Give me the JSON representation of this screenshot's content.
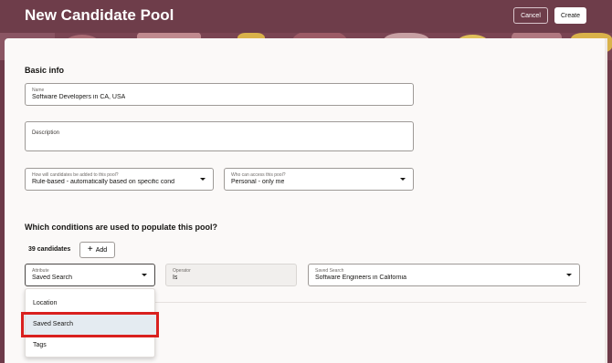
{
  "header": {
    "title": "New Candidate Pool",
    "cancel_label": "Cancel",
    "create_label": "Create"
  },
  "basic_info": {
    "section_title": "Basic info",
    "name_label": "Name",
    "name_value": "Software Developers in CA, USA",
    "description_label": "Description",
    "description_value": "",
    "add_method_label": "How will candidates be added to this pool?",
    "add_method_value": "Rule-based - automatically based on specific cond",
    "access_label": "Who can access this pool?",
    "access_value": "Personal - only me"
  },
  "conditions": {
    "section_title": "Which conditions are used to populate this pool?",
    "count_text": "39 candidates",
    "add_label": "Add",
    "attribute_label": "Attribute",
    "attribute_value": "Saved Search",
    "operator_label": "Operator",
    "operator_value": "Is",
    "saved_search_label": "Saved Search",
    "saved_search_value": "Software Engineers in California"
  },
  "dropdown": {
    "options": [
      "Location",
      "Saved Search",
      "Tags"
    ],
    "highlighted": "Saved Search"
  },
  "colors": {
    "header_bg": "#6e3d4a",
    "highlight_border": "#d9201e",
    "selected_bg": "#e4ebf1"
  }
}
